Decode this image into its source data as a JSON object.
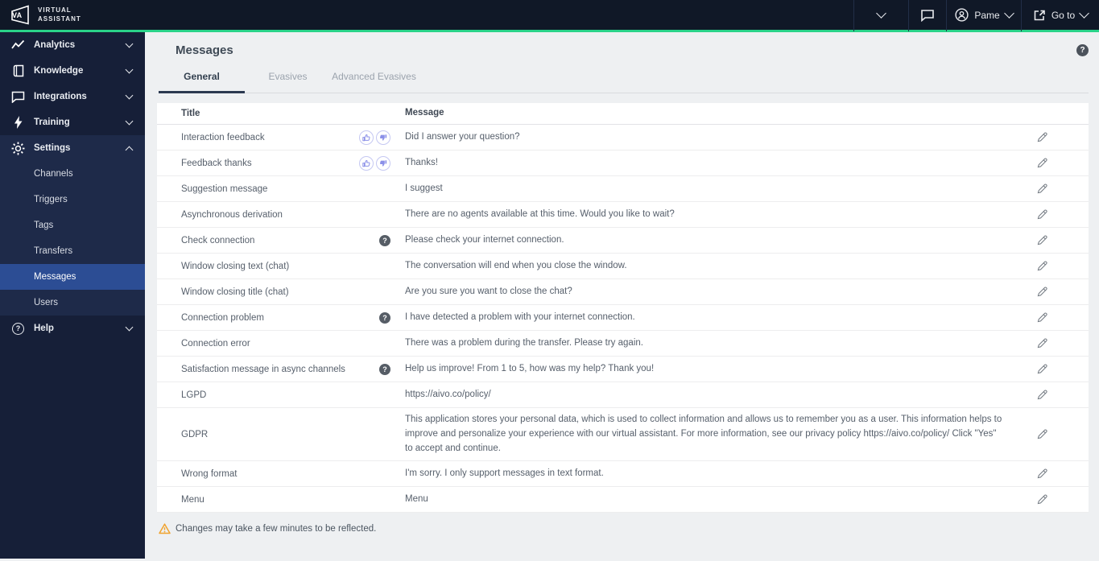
{
  "topbar": {
    "logo": {
      "badge": "VA",
      "line1": "VIRTUAL",
      "line2": "ASSISTANT"
    },
    "user_name": "Pame",
    "goto_label": "Go to"
  },
  "sidebar": {
    "items": [
      {
        "label": "Analytics"
      },
      {
        "label": "Knowledge"
      },
      {
        "label": "Integrations"
      },
      {
        "label": "Training"
      },
      {
        "label": "Settings"
      },
      {
        "label": "Help"
      }
    ],
    "settings_subitems": [
      "Channels",
      "Triggers",
      "Tags",
      "Transfers",
      "Messages",
      "Users"
    ],
    "active_subitem": "Messages"
  },
  "main": {
    "title": "Messages",
    "tabs": [
      {
        "label": "General",
        "active": true
      },
      {
        "label": "Evasives",
        "active": false
      },
      {
        "label": "Advanced Evasives",
        "active": false
      }
    ],
    "table": {
      "columns": {
        "title": "Title",
        "message": "Message"
      },
      "rows": [
        {
          "title": "Interaction feedback",
          "thumbs": true,
          "help": false,
          "message": "Did I answer your question?"
        },
        {
          "title": "Feedback thanks",
          "thumbs": true,
          "help": false,
          "message": "Thanks!"
        },
        {
          "title": "Suggestion message",
          "thumbs": false,
          "help": false,
          "message": "I suggest"
        },
        {
          "title": "Asynchronous derivation",
          "thumbs": false,
          "help": false,
          "message": "There are no agents available at this time. Would you like to wait?"
        },
        {
          "title": "Check connection",
          "thumbs": false,
          "help": true,
          "message": "Please check your internet connection."
        },
        {
          "title": "Window closing text (chat)",
          "thumbs": false,
          "help": false,
          "message": "The conversation will end when you close the window."
        },
        {
          "title": "Window closing title (chat)",
          "thumbs": false,
          "help": false,
          "message": "Are you sure you want to close the chat?"
        },
        {
          "title": "Connection problem",
          "thumbs": false,
          "help": true,
          "message": "I have detected a problem with your internet connection."
        },
        {
          "title": "Connection error",
          "thumbs": false,
          "help": false,
          "message": "There was a problem during the transfer. Please try again."
        },
        {
          "title": "Satisfaction message in async channels",
          "thumbs": false,
          "help": true,
          "message": "Help us improve! From 1 to 5, how was my help? Thank you!"
        },
        {
          "title": "LGPD",
          "thumbs": false,
          "help": false,
          "message": "https://aivo.co/policy/"
        },
        {
          "title": "GDPR",
          "thumbs": false,
          "help": false,
          "message": "This application stores your personal data, which is used to collect information and allows us to remember you as a user. This information helps to improve and personalize your experience with our virtual assistant. For more information, see our privacy policy https://aivo.co/policy/ Click \"Yes\" to accept and continue."
        },
        {
          "title": "Wrong format",
          "thumbs": false,
          "help": false,
          "message": "I'm sorry. I only support messages in text format."
        },
        {
          "title": "Menu",
          "thumbs": false,
          "help": false,
          "message": "Menu"
        }
      ]
    },
    "footer_note": "Changes may take a few minutes to be reflected."
  },
  "colors": {
    "topbar_bg": "#101827",
    "accent_green": "#2ad389",
    "sidebar_bg": "#161f38",
    "settings_section_bg": "#1e2a49",
    "active_item_bg": "#2c4d94",
    "content_bg": "#eef0f2",
    "thumb_icon": "#8b90e8",
    "warning_orange": "#f0a32e"
  }
}
